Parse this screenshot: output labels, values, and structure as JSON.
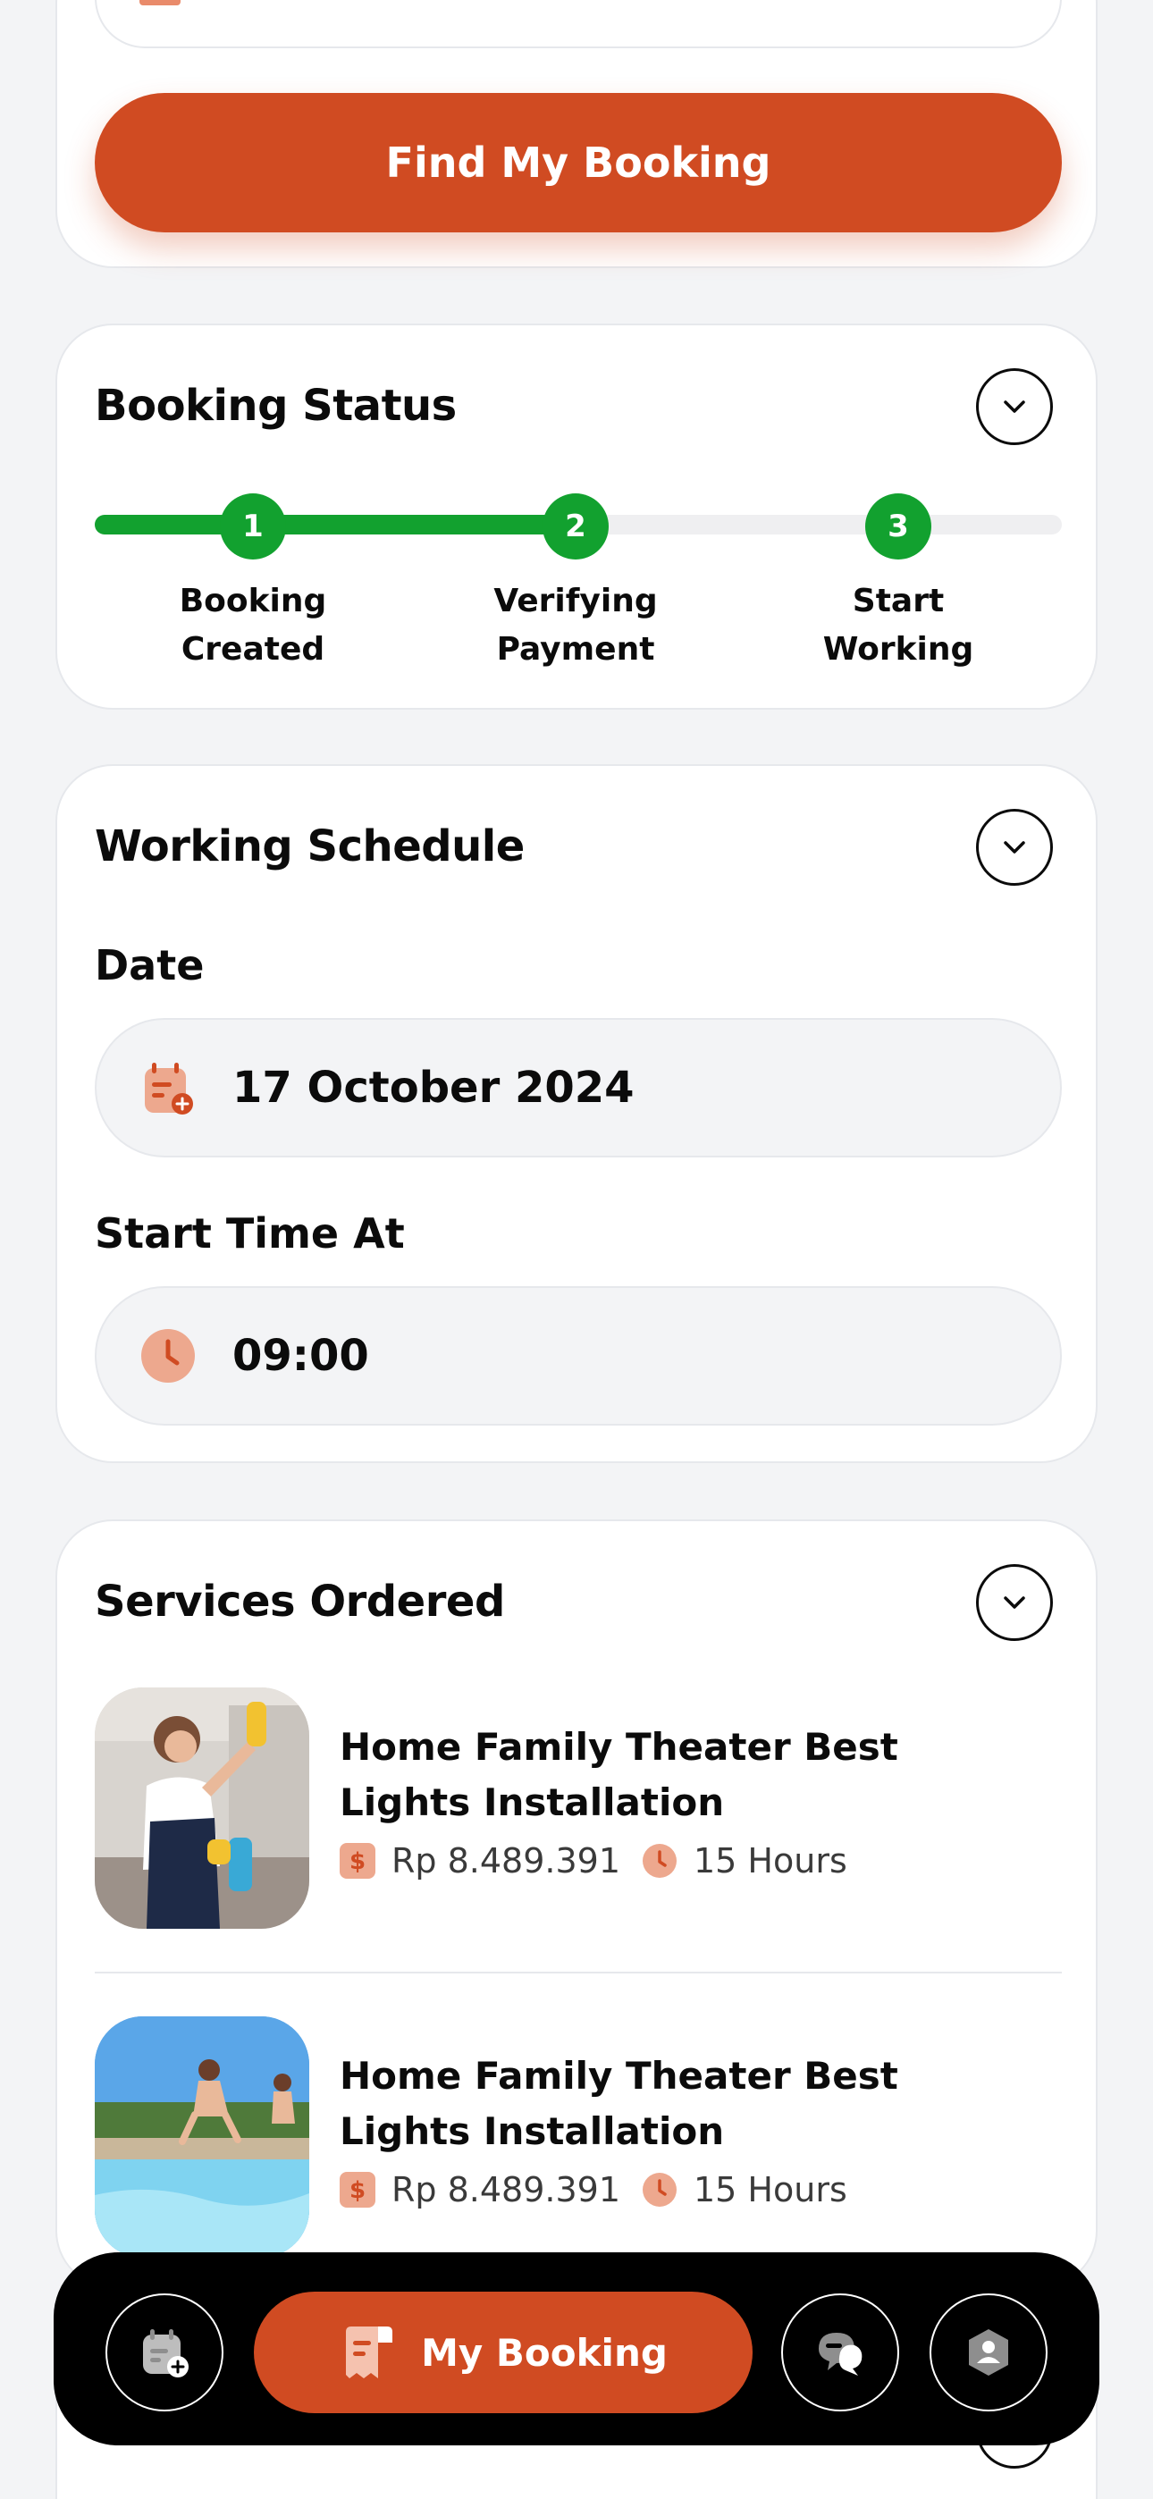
{
  "find_booking": {
    "button_label": "Find My Booking"
  },
  "booking_status": {
    "title": "Booking Status",
    "progress_percent": 50,
    "steps": [
      {
        "number": "1",
        "label_line1": "Booking",
        "label_line2": "Created"
      },
      {
        "number": "2",
        "label_line1": "Verifying",
        "label_line2": "Payment"
      },
      {
        "number": "3",
        "label_line1": "Start",
        "label_line2": "Working"
      }
    ],
    "active_color": "#12A12F"
  },
  "working_schedule": {
    "title": "Working Schedule",
    "date_label": "Date",
    "date_value": "17 October 2024",
    "time_label": "Start Time At",
    "time_value": "09:00"
  },
  "services_ordered": {
    "title": "Services Ordered",
    "items": [
      {
        "title": "Home Family Theater Best Lights Installation",
        "price": "Rp 8.489.391",
        "duration": "15 Hours",
        "image": "woman-cleaning-kitchen-photo"
      },
      {
        "title": "Home Family Theater Best Lights Installation",
        "price": "Rp 8.489.391",
        "duration": "15 Hours",
        "image": "pool-jumping-photo"
      }
    ]
  },
  "bottom_nav": {
    "main_label": "My Booking",
    "icons": [
      "calendar-add-icon",
      "receipt-icon",
      "chat-icon",
      "profile-icon"
    ]
  },
  "colors": {
    "accent": "#D04B22",
    "success": "#12A12F",
    "background": "#F3F4F6"
  }
}
